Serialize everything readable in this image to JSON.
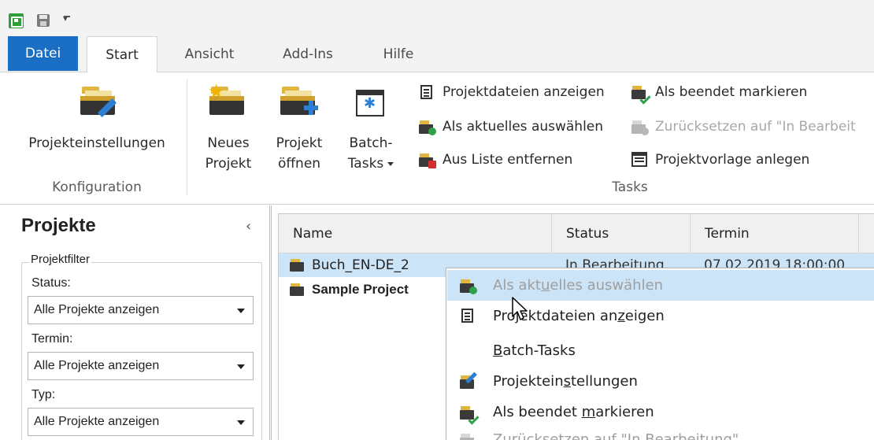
{
  "ribbon_tabs": {
    "datei": "Datei",
    "start": "Start",
    "ansicht": "Ansicht",
    "addins": "Add-Ins",
    "hilfe": "Hilfe"
  },
  "ribbon": {
    "projekteinstellungen": "Projekteinstellungen",
    "konfiguration_label": "Konfiguration",
    "neues_projekt_1": "Neues",
    "neues_projekt_2": "Projekt",
    "projekt_oeffnen_1": "Projekt",
    "projekt_oeffnen_2": "öffnen",
    "batch_tasks_1": "Batch-",
    "batch_tasks_2": "Tasks",
    "projektdateien_anzeigen": "Projektdateien anzeigen",
    "als_aktuelles_auswaehlen": "Als aktuelles auswählen",
    "aus_liste_entfernen": "Aus Liste entfernen",
    "als_beendet_markieren": "Als beendet markieren",
    "zuruecksetzen": "Zurücksetzen auf \"In Bearbeit",
    "projektvorlage_anlegen": "Projektvorlage anlegen",
    "tasks_label": "Tasks"
  },
  "left_panel": {
    "title": "Projekte",
    "collapse": "‹",
    "filter_legend": "Projektfilter",
    "status_label": "Status:",
    "status_value": "Alle Projekte anzeigen",
    "termin_label": "Termin:",
    "termin_value": "Alle Projekte anzeigen",
    "typ_label": "Typ:",
    "typ_value": "Alle Projekte anzeigen"
  },
  "grid": {
    "col_name": "Name",
    "col_status": "Status",
    "col_termin": "Termin",
    "rows": [
      {
        "name": "Buch_EN-DE_2",
        "status": "In Bearbeitung",
        "termin": "07.02.2019 18:00:00"
      },
      {
        "name": "Sample Project",
        "status": "",
        "termin": ""
      }
    ]
  },
  "context_menu": {
    "item_aktuelles_pre": "Als akt",
    "item_aktuelles_u": "u",
    "item_aktuelles_post": "elles auswählen",
    "item_dateien_pre": "Projektdateien an",
    "item_dateien_u": "z",
    "item_dateien_post": "eigen",
    "item_batch_u": "B",
    "item_batch_post": "atch-Tasks",
    "item_einst_pre": "Projektein",
    "item_einst_u": "s",
    "item_einst_post": "tellungen",
    "item_beendet_pre": "Als beendet ",
    "item_beendet_u": "m",
    "item_beendet_post": "arkieren",
    "item_zurueck": "Zurücksetzen auf \"In Bearbeitung\""
  }
}
